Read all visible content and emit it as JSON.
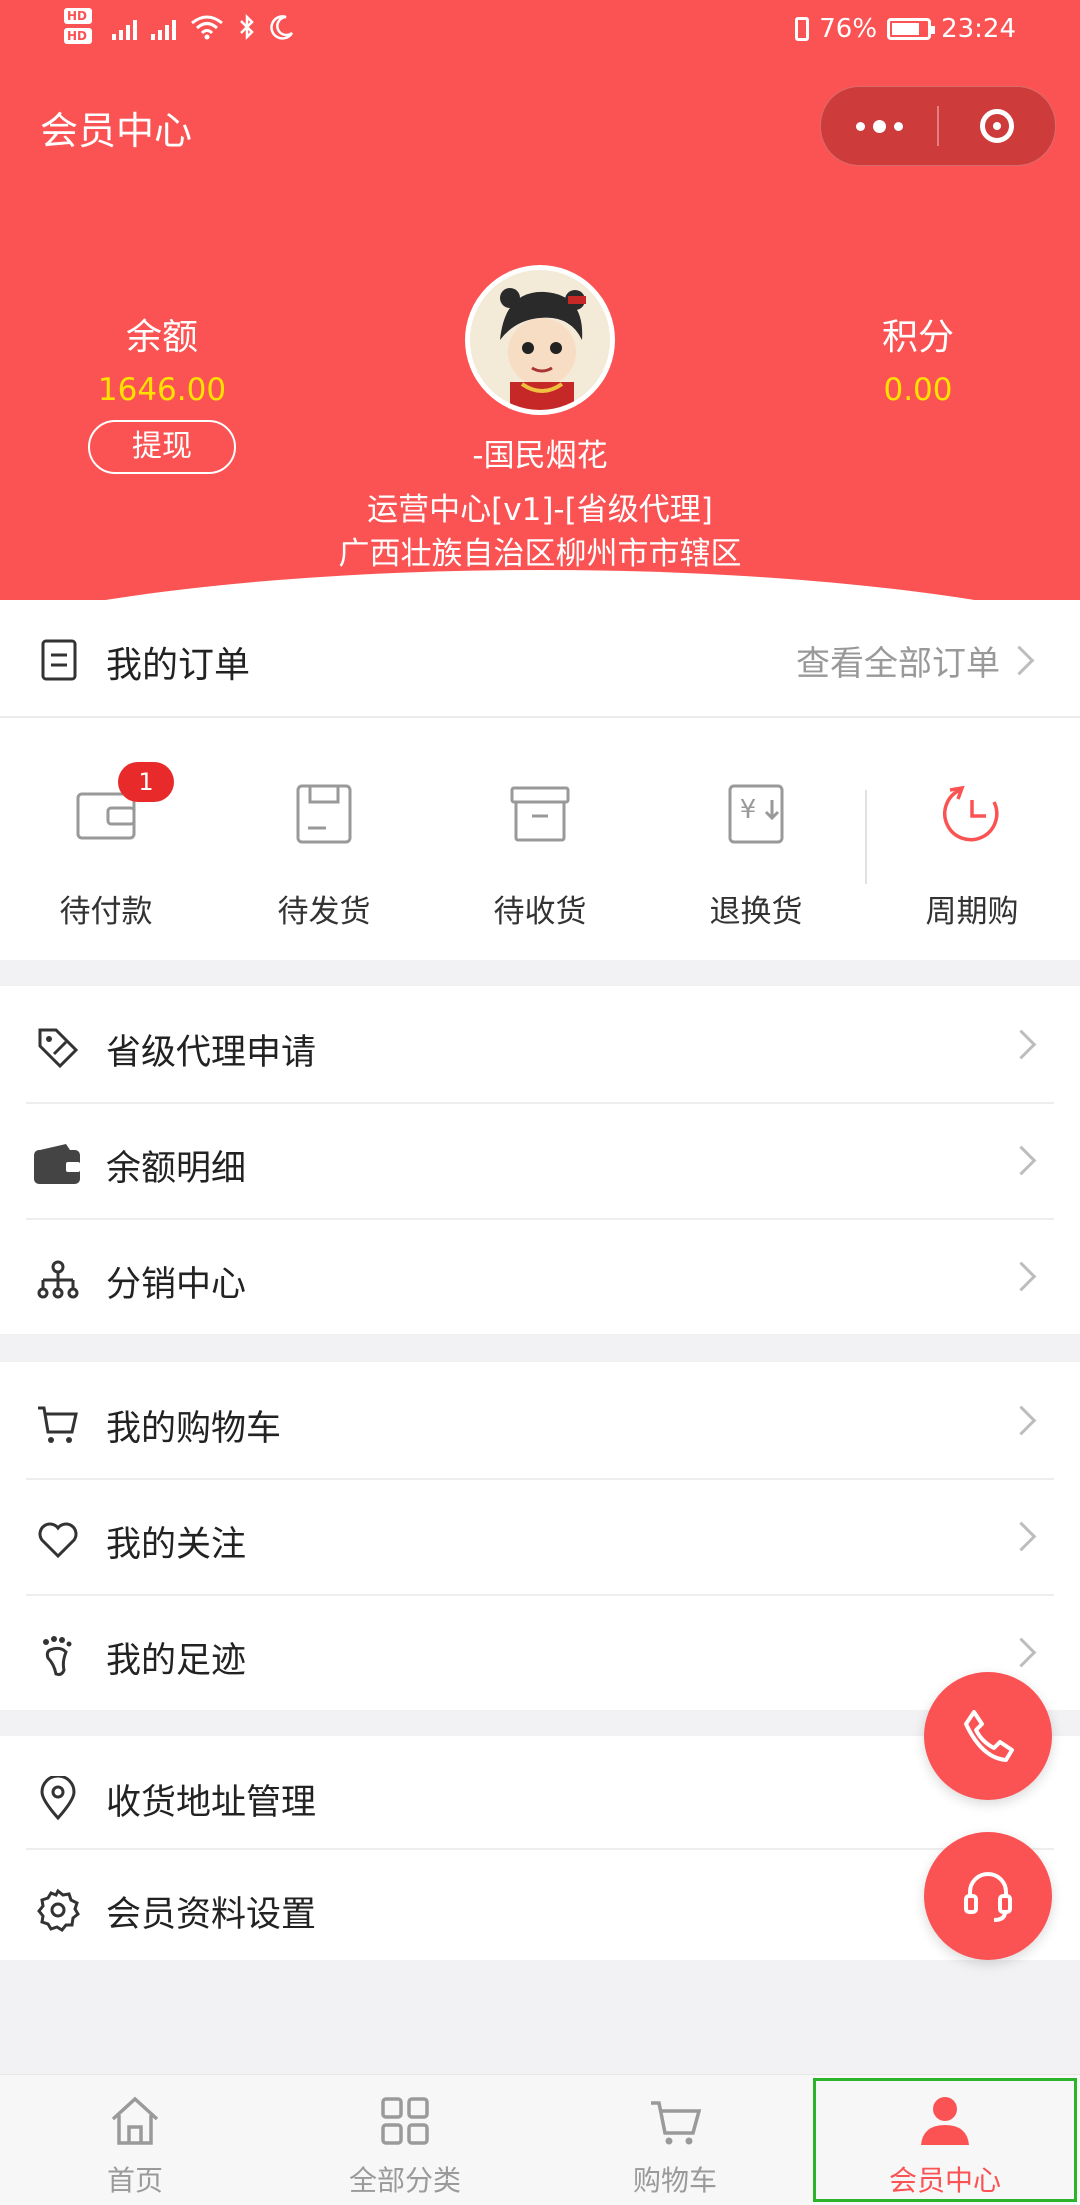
{
  "status_bar": {
    "hd": "HD",
    "network": "4G",
    "battery_text": "76%",
    "time": "23:24"
  },
  "nav": {
    "title": "会员中心"
  },
  "profile": {
    "balance_label": "余额",
    "balance_value": "1646.00",
    "withdraw_label": "提现",
    "points_label": "积分",
    "points_value": "0.00",
    "username": "-国民烟花",
    "role": "运营中心[v1]-[省级代理]",
    "region": "广西壮族自治区柳州市市辖区"
  },
  "orders": {
    "title": "我的订单",
    "view_all": "查看全部订单",
    "items": [
      {
        "label": "待付款",
        "icon": "wallet-icon",
        "badge": "1"
      },
      {
        "label": "待发货",
        "icon": "box-icon"
      },
      {
        "label": "待收货",
        "icon": "package-icon"
      },
      {
        "label": "退换货",
        "icon": "yen-return-icon"
      },
      {
        "label": "周期购",
        "icon": "clock-icon"
      }
    ]
  },
  "menu_groups": [
    {
      "items": [
        {
          "label": "省级代理申请",
          "icon": "tag-icon"
        },
        {
          "label": "余额明细",
          "icon": "wallet-icon"
        },
        {
          "label": "分销中心",
          "icon": "hierarchy-icon"
        }
      ]
    },
    {
      "items": [
        {
          "label": "我的购物车",
          "icon": "cart-icon"
        },
        {
          "label": "我的关注",
          "icon": "heart-icon"
        },
        {
          "label": "我的足迹",
          "icon": "footprint-icon"
        }
      ]
    },
    {
      "items": [
        {
          "label": "收货地址管理",
          "icon": "location-icon"
        },
        {
          "label": "会员资料设置",
          "icon": "settings-icon"
        }
      ]
    }
  ],
  "floating": {
    "phone_icon": "phone-icon",
    "service_icon": "headset-icon"
  },
  "tabbar": {
    "items": [
      {
        "label": "首页",
        "icon": "home-icon"
      },
      {
        "label": "全部分类",
        "icon": "grid-icon"
      },
      {
        "label": "购物车",
        "icon": "cart-icon"
      },
      {
        "label": "会员中心",
        "icon": "user-icon",
        "active": true
      }
    ]
  },
  "colors": {
    "brand": "#fb5353",
    "highlight_value": "#ffe100",
    "badge": "#e82a2a"
  }
}
